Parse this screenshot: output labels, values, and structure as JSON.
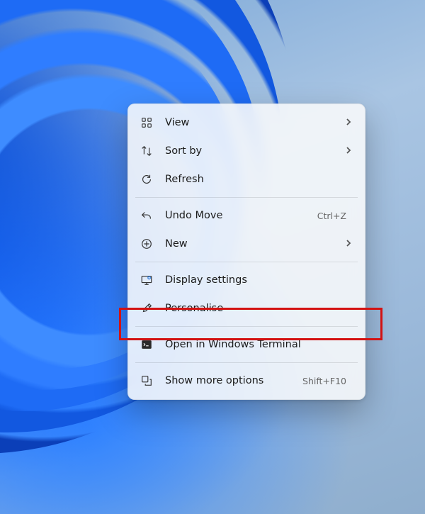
{
  "menu": {
    "view": {
      "label": "View",
      "has_submenu": true
    },
    "sort_by": {
      "label": "Sort by",
      "has_submenu": true
    },
    "refresh": {
      "label": "Refresh"
    },
    "undo_move": {
      "label": "Undo Move",
      "shortcut": "Ctrl+Z"
    },
    "new": {
      "label": "New",
      "has_submenu": true
    },
    "display_settings": {
      "label": "Display settings"
    },
    "personalise": {
      "label": "Personalise"
    },
    "open_in_terminal": {
      "label": "Open in Windows Terminal"
    },
    "show_more_options": {
      "label": "Show more options",
      "shortcut": "Shift+F10"
    }
  },
  "highlighted_item": "personalise"
}
